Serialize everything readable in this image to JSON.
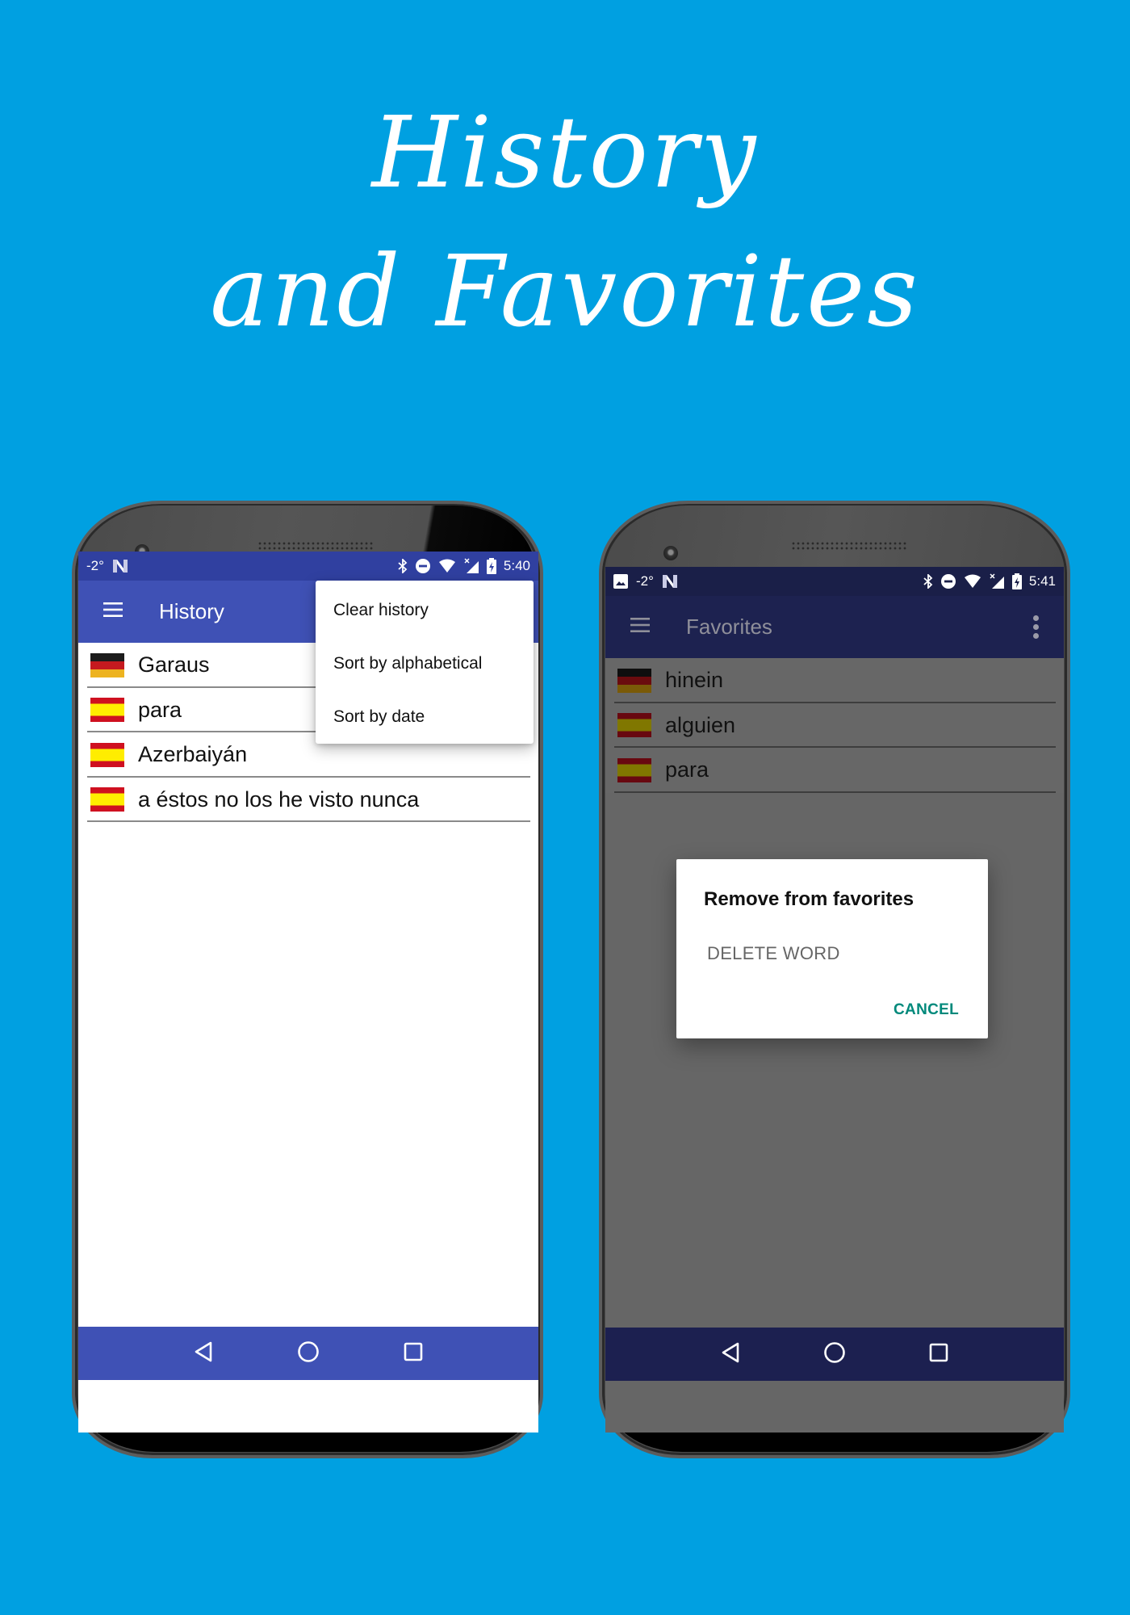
{
  "headline": {
    "line1": "History",
    "line2": "and Favorites"
  },
  "history_screen": {
    "status": {
      "temperature": "-2°",
      "time": "5:40"
    },
    "appbar": {
      "title": "History",
      "menu_icon": "hamburger-menu-icon"
    },
    "items": [
      {
        "flag": "germany",
        "word": "Garaus"
      },
      {
        "flag": "spain",
        "word": "para"
      },
      {
        "flag": "spain",
        "word": "Azerbaiyán"
      },
      {
        "flag": "spain",
        "word": "a éstos no los he visto nunca"
      }
    ],
    "overflow_menu": {
      "items": [
        "Clear history",
        "Sort by alphabetical",
        "Sort by date"
      ]
    },
    "colors": {
      "primary": "#3f51b5",
      "primary_dark": "#3040a0"
    }
  },
  "favorites_screen": {
    "status": {
      "temperature": "-2°",
      "time": "5:41"
    },
    "appbar": {
      "title": "Favorites",
      "menu_icon": "hamburger-menu-icon",
      "overflow_icon": "more-vert-icon"
    },
    "items": [
      {
        "flag": "germany",
        "word": "hinein"
      },
      {
        "flag": "spain",
        "word": "alguien"
      },
      {
        "flag": "spain",
        "word": "para"
      }
    ],
    "dialog": {
      "title": "Remove from favorites",
      "option": "DELETE WORD",
      "cancel": "CANCEL"
    },
    "colors": {
      "accent": "#00897b"
    }
  },
  "navbar": {
    "icons": [
      "back-icon",
      "home-icon",
      "recents-icon"
    ]
  }
}
